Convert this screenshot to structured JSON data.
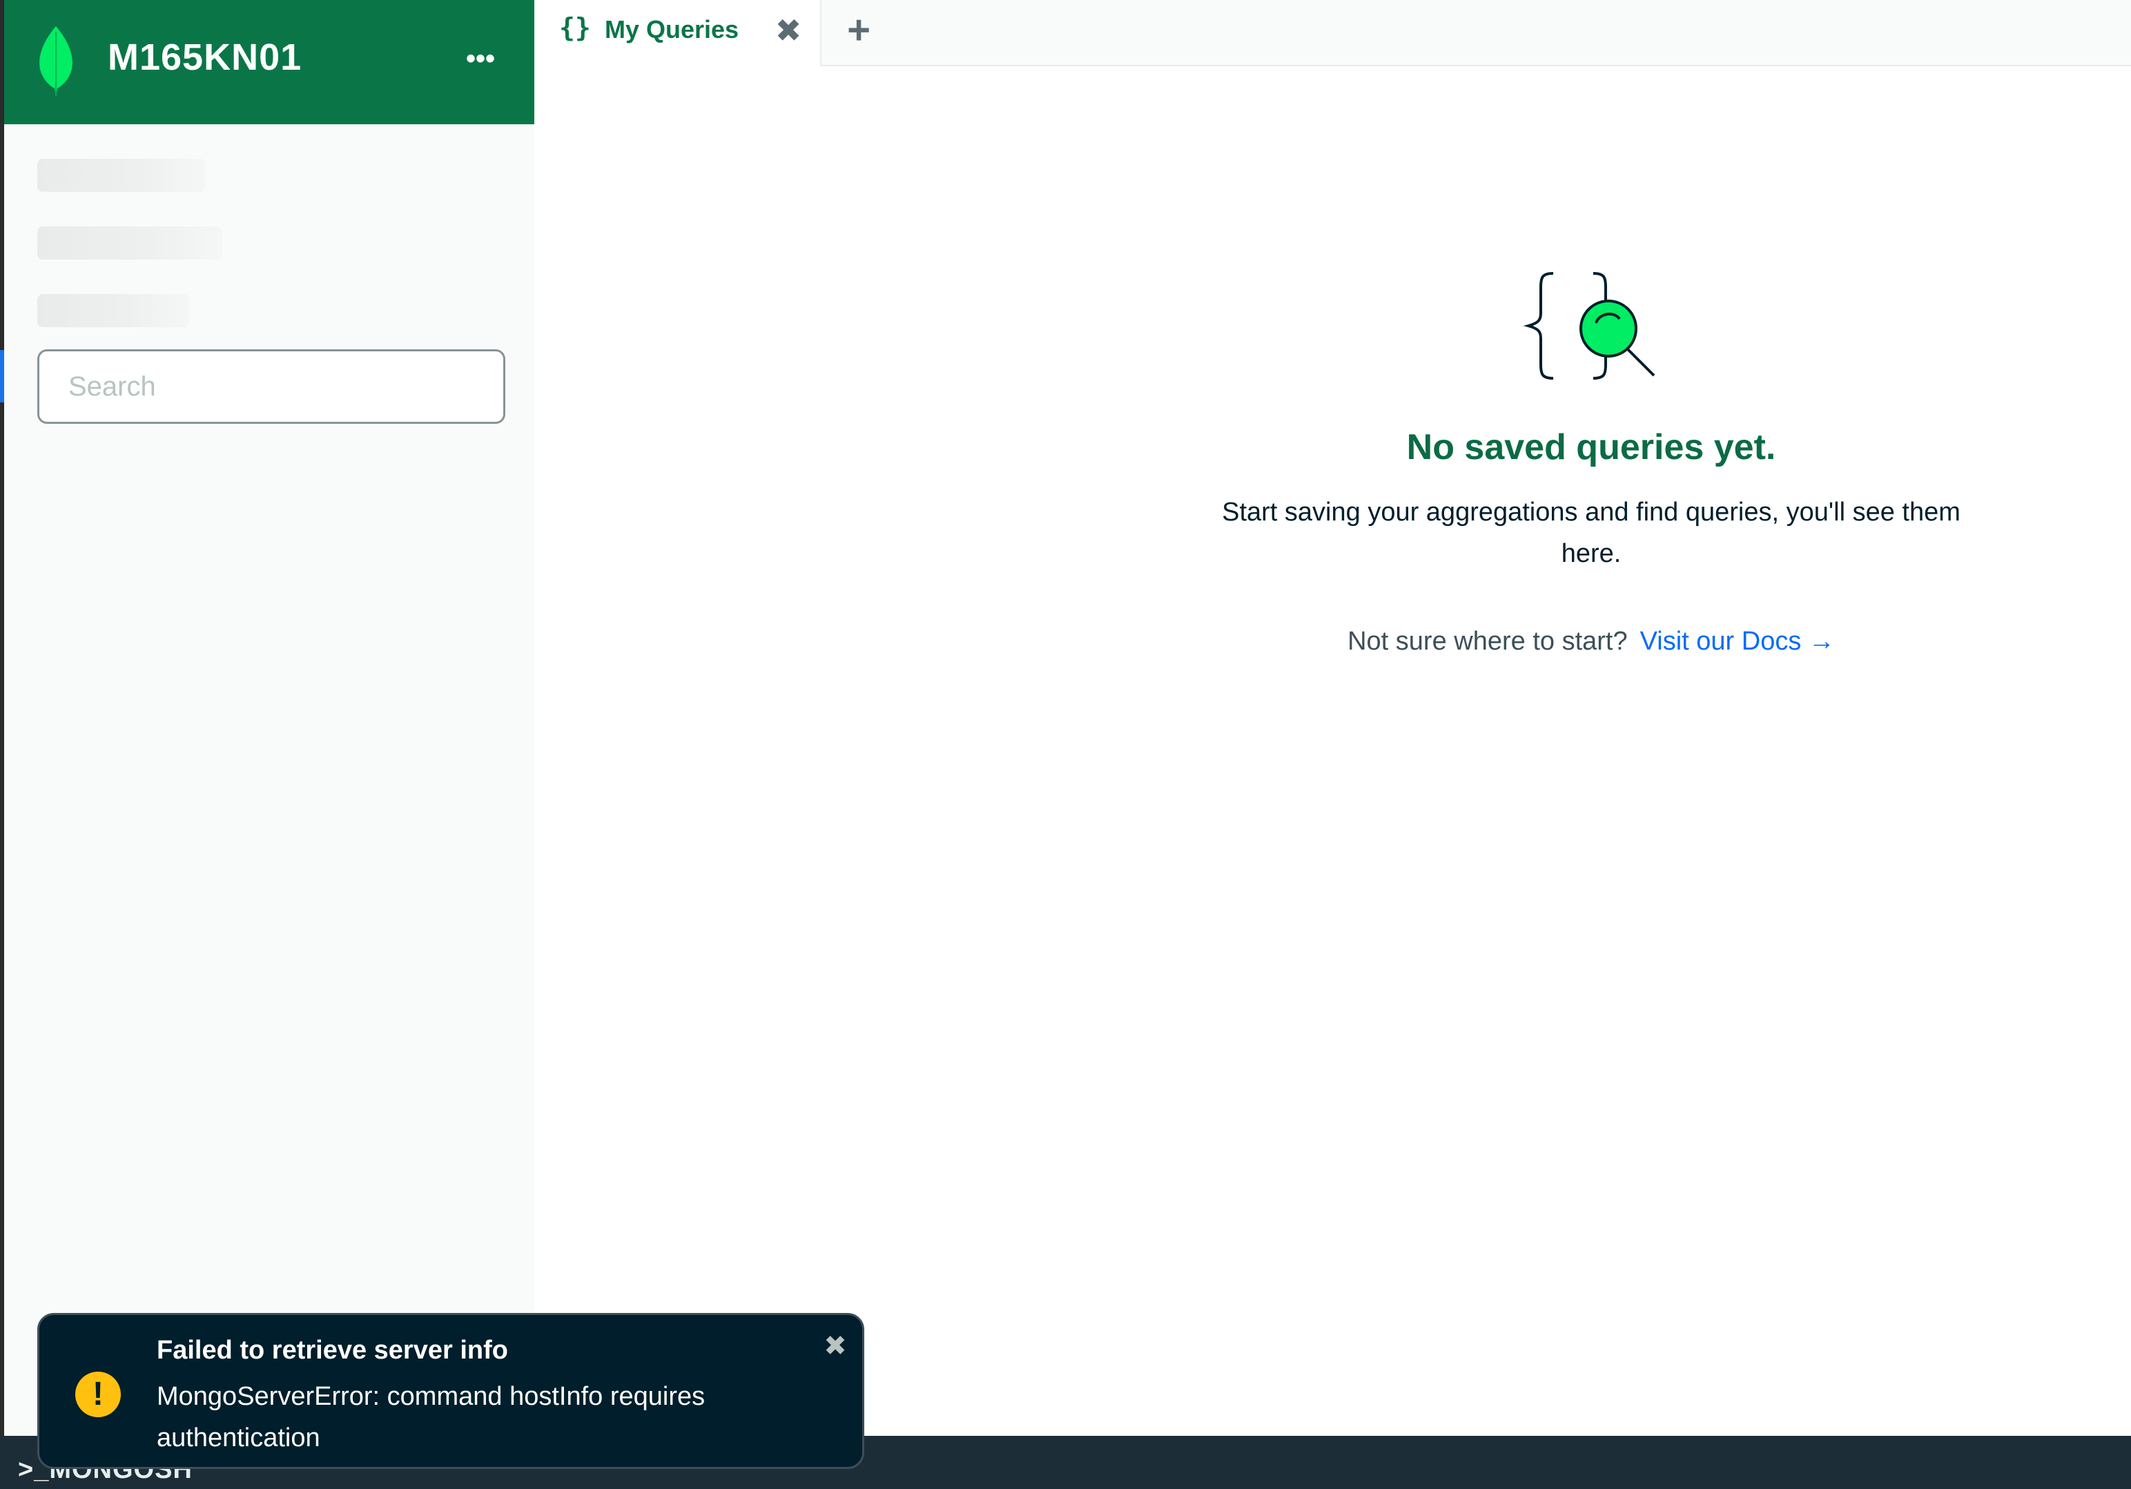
{
  "sidebar": {
    "connection_name": "M165KN01",
    "more_label": "•••",
    "search_placeholder": "Search",
    "leaf_color": "#00ed64"
  },
  "tabs": [
    {
      "icon": "{}",
      "label": "My Queries",
      "active": true
    }
  ],
  "tab_close_label": "✖",
  "tab_add_label": "+",
  "empty_state": {
    "title": "No saved queries yet.",
    "description": "Start saving your aggregations and find queries, you'll see them here.",
    "hint": "Not sure where to start?",
    "link_label": "Visit our Docs →"
  },
  "toast": {
    "title": "Failed to retrieve server info",
    "message": "MongoServerError: command hostInfo requires authentication",
    "icon": "!",
    "close_label": "✖"
  },
  "shell": {
    "label": ">_MONGOSH"
  },
  "colors": {
    "brand_green": "#0a7648",
    "accent_green": "#00ed64",
    "link_blue": "#016bf8",
    "toast_bg": "#001e2b",
    "warning_yellow": "#ffc010"
  }
}
